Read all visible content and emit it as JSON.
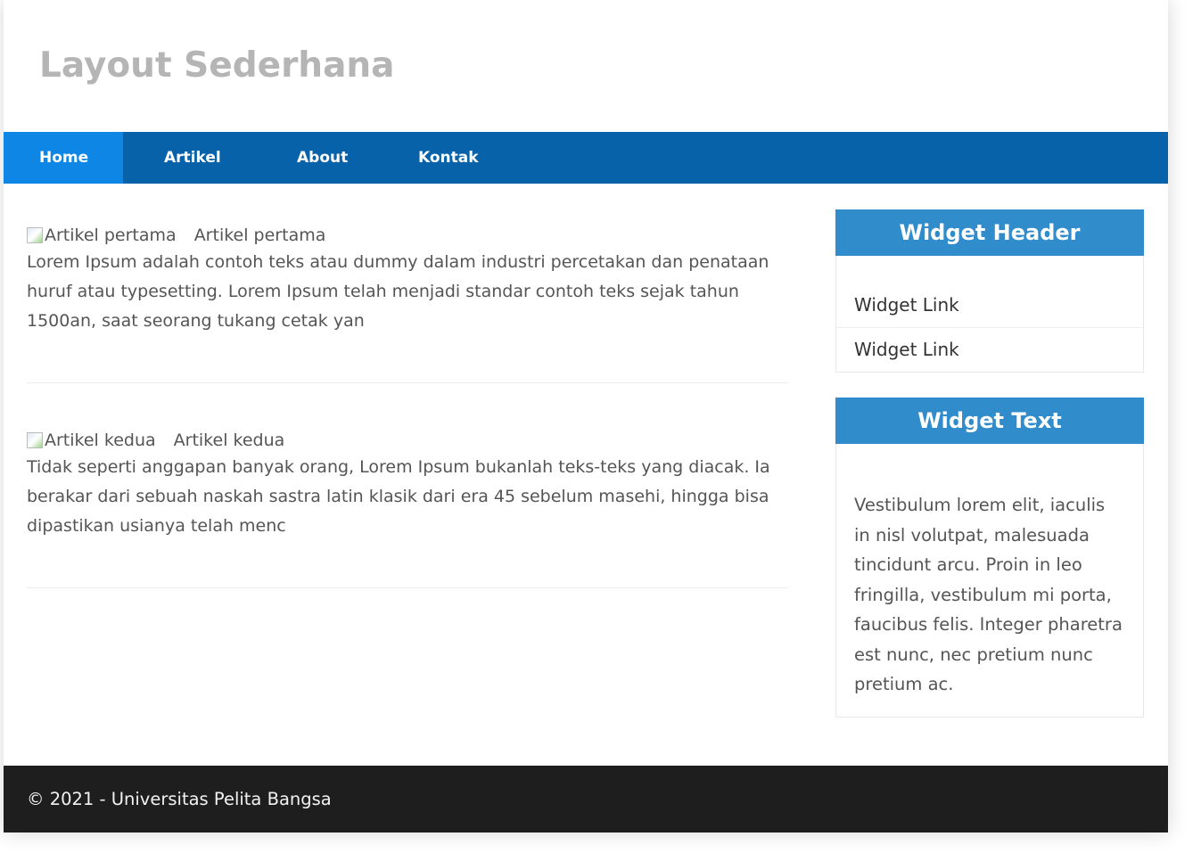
{
  "header": {
    "title": "Layout Sederhana"
  },
  "nav": {
    "items": [
      {
        "label": "Home",
        "active": true
      },
      {
        "label": "Artikel",
        "active": false
      },
      {
        "label": "About",
        "active": false
      },
      {
        "label": "Kontak",
        "active": false
      }
    ]
  },
  "articles": [
    {
      "image_alt": "Artikel pertama",
      "title": "Artikel pertama",
      "body": "Lorem Ipsum adalah contoh teks atau dummy dalam industri percetakan dan penataan huruf atau typesetting. Lorem Ipsum telah menjadi standar contoh teks sejak tahun 1500an, saat seorang tukang cetak yan"
    },
    {
      "image_alt": "Artikel kedua",
      "title": "Artikel kedua",
      "body": "Tidak seperti anggapan banyak orang, Lorem Ipsum bukanlah teks-teks yang diacak. Ia berakar dari sebuah naskah sastra latin klasik dari era 45 sebelum masehi, hingga bisa dipastikan usianya telah menc"
    }
  ],
  "sidebar": {
    "widget_links": {
      "header": "Widget Header",
      "links": [
        "Widget Link",
        "Widget Link"
      ]
    },
    "widget_text": {
      "header": "Widget Text",
      "text": "Vestibulum lorem elit, iaculis in nisl volutpat, malesuada tincidunt arcu. Proin in leo fringilla, vestibulum mi porta, faucibus felis. Integer pharetra est nunc, nec pretium nunc pretium ac."
    }
  },
  "footer": {
    "text": "© 2021 - Universitas Pelita Bangsa"
  },
  "colors": {
    "nav_bg": "#0762a9",
    "nav_active_bg": "#0d86e6",
    "widget_header_bg": "#318ccb",
    "footer_bg": "#1e1e1e",
    "title_color": "#b5b5b5"
  }
}
